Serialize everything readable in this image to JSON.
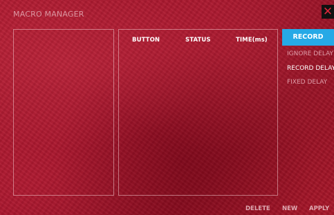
{
  "window": {
    "title": "MACRO MANAGER",
    "close_symbol": "✕",
    "close_icon": "close-icon"
  },
  "table": {
    "columns": [
      "BUTTON",
      "STATUS",
      "TIME(ms)"
    ],
    "rows": []
  },
  "macro_list": {
    "items": []
  },
  "controls": {
    "record_label": "RECORD",
    "delay_options": [
      {
        "label": "IGNORE DELAY",
        "selected": false
      },
      {
        "label": "RECORD DELAY",
        "selected": true
      },
      {
        "label": "FIXED DELAY",
        "selected": false
      }
    ]
  },
  "footer": {
    "delete_label": "DELETE",
    "new_label": "NEW",
    "apply_label": "APPLY"
  },
  "colors": {
    "background": "#a3132a",
    "accent": "#26a9e6",
    "close_icon": "#e0283c"
  }
}
